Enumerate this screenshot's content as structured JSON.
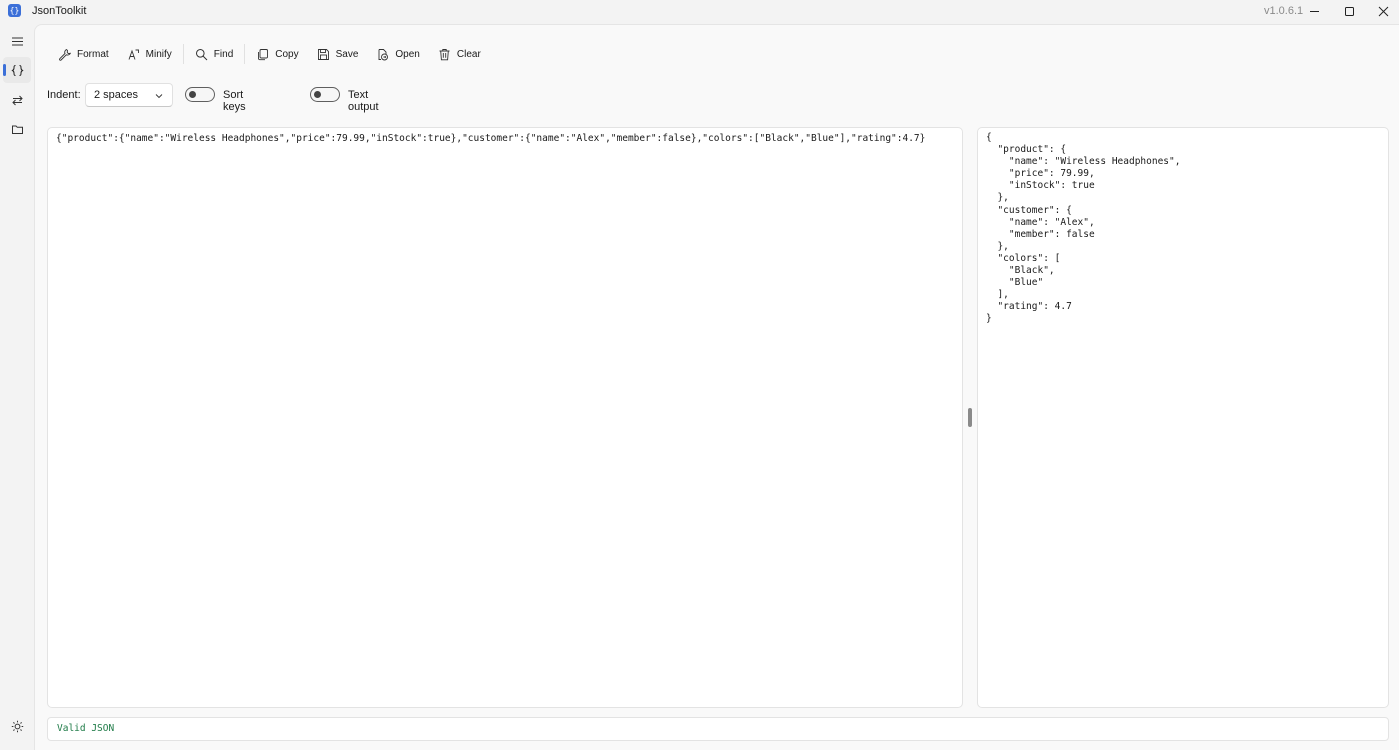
{
  "window": {
    "title": "JsonToolkit",
    "version": "v1.0.6.1",
    "icon": "braces-app-icon",
    "icon_glyph": "{}"
  },
  "rail": {
    "items": [
      {
        "name": "menu",
        "icon": "hamburger-icon"
      },
      {
        "name": "formatter",
        "icon": "braces-icon",
        "active": true
      },
      {
        "name": "convert",
        "icon": "swap-icon"
      },
      {
        "name": "files",
        "icon": "folder-icon"
      }
    ],
    "theme_icon": "sun-icon"
  },
  "toolbar": {
    "format_label": "Format",
    "minify_label": "Minify",
    "find_label": "Find",
    "copy_label": "Copy",
    "save_label": "Save",
    "open_label": "Open",
    "clear_label": "Clear"
  },
  "options": {
    "indent_label": "Indent:",
    "indent_value": "2 spaces",
    "sort_keys_label": "Sort keys",
    "sort_keys_on": false,
    "text_output_label": "Text output",
    "text_output_on": false
  },
  "input": {
    "text": "{\"product\":{\"name\":\"Wireless Headphones\",\"price\":79.99,\"inStock\":true},\"customer\":{\"name\":\"Alex\",\"member\":false},\"colors\":[\"Black\",\"Blue\"],\"rating\":4.7}"
  },
  "output": {
    "text": "{\n  \"product\": {\n    \"name\": \"Wireless Headphones\",\n    \"price\": 79.99,\n    \"inStock\": true\n  },\n  \"customer\": {\n    \"name\": \"Alex\",\n    \"member\": false\n  },\n  \"colors\": [\n    \"Black\",\n    \"Blue\"\n  ],\n  \"rating\": 4.7\n}"
  },
  "status": {
    "text": "Valid JSON",
    "color": "#1d7a46"
  },
  "colors": {
    "accent": "#3b6fd8",
    "background": "#f3f3f3",
    "content_bg": "#f9f9f9"
  }
}
